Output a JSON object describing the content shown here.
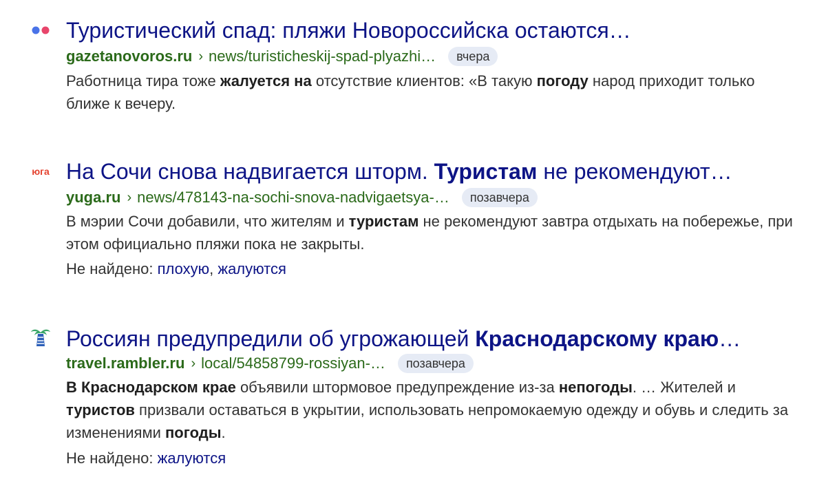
{
  "results": [
    {
      "favicon_icon": "two-dots-icon",
      "title_parts": [
        "Туристический спад: пляжи Новороссийска остаются…"
      ],
      "domain": "gazetanovoros.ru",
      "separator": "›",
      "path": "news/turisticheskij-spad-plyazhi…",
      "date": "вчера",
      "snippet_parts": [
        {
          "text": "Работница тира тоже ",
          "bold": false
        },
        {
          "text": "жалуется на",
          "bold": true
        },
        {
          "text": " отсутствие клиентов: «В такую ",
          "bold": false
        },
        {
          "text": "погоду",
          "bold": true
        },
        {
          "text": " народ приходит только ближе к вечеру.",
          "bold": false
        }
      ]
    },
    {
      "favicon_icon": "yuga-logo-icon",
      "favicon_text": "юга",
      "title_parts": [
        "На Сочи снова надвигается шторм. ",
        "Туристам",
        " не рекомендуют…"
      ],
      "domain": "yuga.ru",
      "separator": "›",
      "path": "news/478143-na-sochi-snova-nadvigaetsya-…",
      "date": "позавчера",
      "snippet_parts": [
        {
          "text": "В мэрии Сочи добавили, что жителям и ",
          "bold": false
        },
        {
          "text": "туристам",
          "bold": true
        },
        {
          "text": " не рекомендуют завтра отдыхать на по­бережье, при этом официально пляжи пока не закрыты.",
          "bold": false
        }
      ],
      "missing_label": "Не найдено:",
      "missing_words": [
        "плохую",
        "жалуются"
      ],
      "missing_separator": ","
    },
    {
      "favicon_icon": "palm-tree-icon",
      "title_parts": [
        "Россиян предупредили об угрожающей ",
        "Краснодарскому краю",
        "…"
      ],
      "domain": "travel.rambler.ru",
      "separator": "›",
      "path": "local/54858799-rossiyan-…",
      "date": "позавчера",
      "snippet_parts": [
        {
          "text": "В Краснодарском крае",
          "bold": true
        },
        {
          "text": " объявили штормовое предупреждение из-за ",
          "bold": false
        },
        {
          "text": "непогоды",
          "bold": true
        },
        {
          "text": ". … Жите­лей и ",
          "bold": false
        },
        {
          "text": "туристов",
          "bold": true
        },
        {
          "text": " призвали оставаться в укрытии, использовать непромокаемую одежду и обувь и следить за изменениями ",
          "bold": false
        },
        {
          "text": "погоды",
          "bold": true
        },
        {
          "text": ".",
          "bold": false
        }
      ],
      "missing_label": "Не найдено:",
      "missing_words": [
        "жалуются"
      ]
    }
  ],
  "colors": {
    "title": "#0d1486",
    "url": "#2b6a1a",
    "snippet": "#333333",
    "badge_bg": "#e6ebf5",
    "dot_blue": "#4a73e8",
    "dot_red": "#e8456b",
    "yuga_red": "#e4412e",
    "palm_green": "#3aa668",
    "palm_blue": "#2c5fb8"
  }
}
